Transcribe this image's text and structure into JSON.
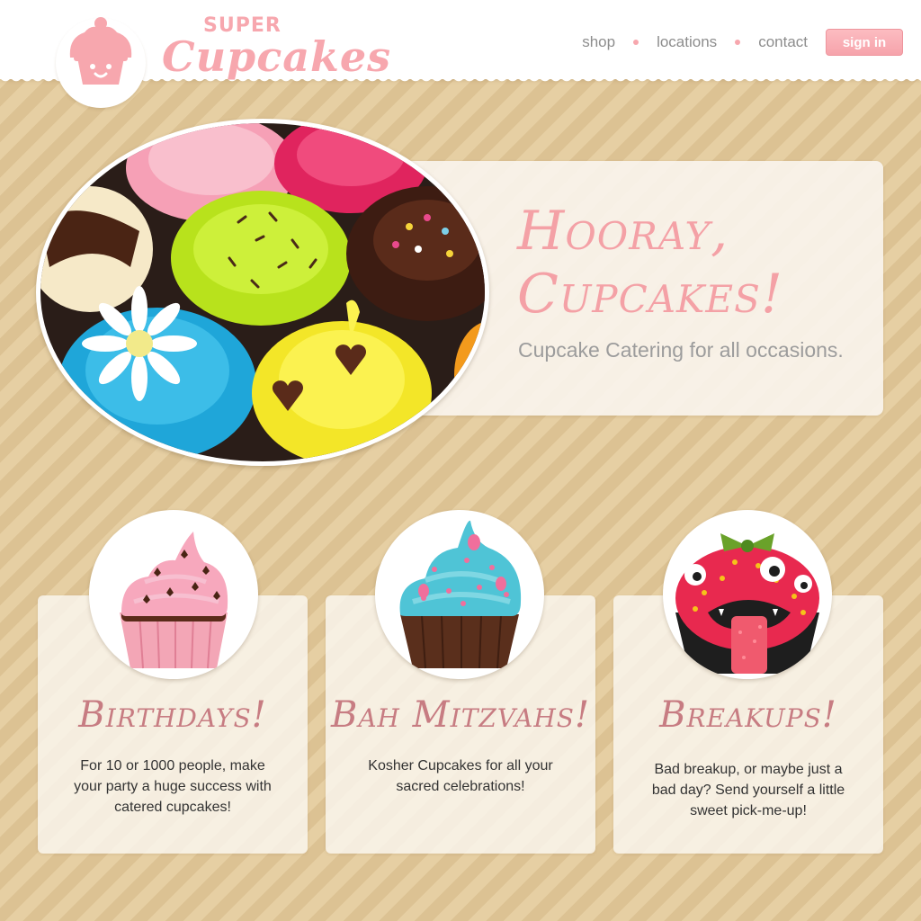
{
  "brand": {
    "super": "SUPER",
    "name": "Cupcakes",
    "pink": "#f7a7ae"
  },
  "nav": {
    "items": [
      "shop",
      "locations",
      "contact"
    ],
    "sign_in": "sign in"
  },
  "hero": {
    "title_line1": "Hooray,",
    "title_line2": "Cupcakes!",
    "subtitle": "Cupcake Catering for all occasions.",
    "image": "assorted-cupcakes-photo"
  },
  "cards": [
    {
      "title": "Birthdays!",
      "text": "For 10 or 1000 people, make your party a huge success with catered cupcakes!",
      "image": "pink-frosting-cupcake-photo"
    },
    {
      "title": "Bah Mitzvahs!",
      "text": "Kosher Cupcakes for all your sacred celebrations!",
      "image": "blue-frosting-cupcake-photo"
    },
    {
      "title": "Breakups!",
      "text": "Bad breakup, or maybe just a bad day? Send yourself a little sweet pick-me-up!",
      "image": "monster-cupcake-photo"
    }
  ]
}
